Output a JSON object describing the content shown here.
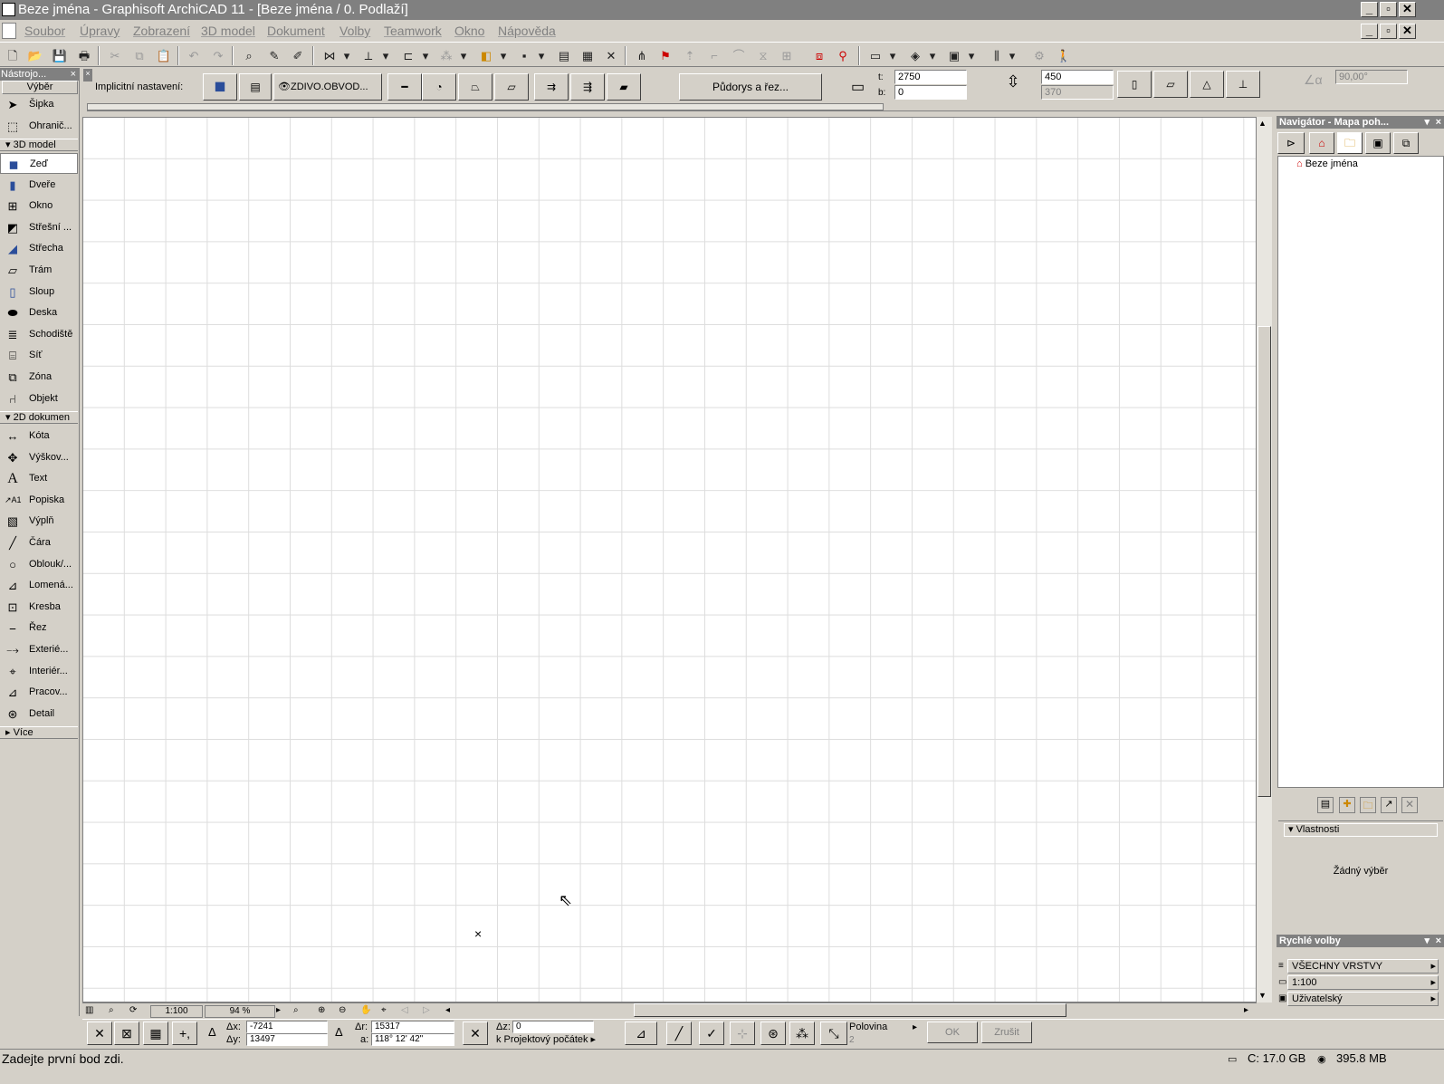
{
  "window": {
    "title": "Beze jména - Graphisoft ArchiCAD 11 - [Beze jména / 0. Podlaží]"
  },
  "menu": [
    "Soubor",
    "Úpravy",
    "Zobrazení",
    "3D model",
    "Dokument",
    "Volby",
    "Teamwork",
    "Okno",
    "Nápověda"
  ],
  "toolbox": {
    "title": "Nástrojo...",
    "select": "Výběr",
    "arrow": "Šipka",
    "marquee": "Ohranič...",
    "group_3d": "3D model",
    "wall": "Zeď",
    "door": "Dveře",
    "window": "Okno",
    "skylight": "Střešní ...",
    "roof": "Střecha",
    "beam": "Trám",
    "column": "Sloup",
    "slab": "Deska",
    "stair": "Schodiště",
    "mesh": "Síť",
    "zone": "Zóna",
    "object": "Objekt",
    "group_2d": "2D dokumen",
    "dimension": "Kóta",
    "level": "Výškov...",
    "text": "Text",
    "label": "Popiska",
    "fill": "Výplň",
    "line": "Čára",
    "arc": "Oblouk/...",
    "polyline": "Lomená...",
    "drawing": "Kresba",
    "section": "Řez",
    "elevation": "Exterié...",
    "interior": "Interiér...",
    "worksheet": "Pracov...",
    "detail": "Detail",
    "more": "Více"
  },
  "infobox": {
    "label": "Implicitní nastavení:",
    "material": "ZDIVO.OBVOD...",
    "floorplan_btn": "Půdorys a řez...",
    "t_label": "t:",
    "t_value": "2750",
    "b_label": "b:",
    "b_value": "0",
    "thickness": "450",
    "thickness2": "370",
    "angle": "90,00°"
  },
  "view": {
    "scale": "1:100",
    "zoom": "94 %"
  },
  "navigator": {
    "title": "Navigátor - Mapa poh...",
    "project": "Beze jména",
    "props_label": "Vlastnosti",
    "no_selection": "Žádný výběr"
  },
  "quick": {
    "title": "Rychlé volby",
    "layers": "VŠECHNY VRSTVY",
    "scale": "1:100",
    "custom": "Uživatelský"
  },
  "coords": {
    "dx_label": "Δx:",
    "dx": "-7241",
    "dy_label": "Δy:",
    "dy": "13497",
    "dr_label": "Δr:",
    "dr": "15317",
    "a_label": "a:",
    "a": "118° 12' 42\"",
    "dz_label": "Δz:",
    "dz": "0",
    "origin": "k Projektový počátek",
    "snap": "Polovina",
    "snap_num": "2",
    "ok": "OK",
    "cancel": "Zrušit"
  },
  "status": {
    "message": "Zadejte první bod zdi.",
    "disk": "C: 17.0 GB",
    "memory": "395.8 MB"
  }
}
